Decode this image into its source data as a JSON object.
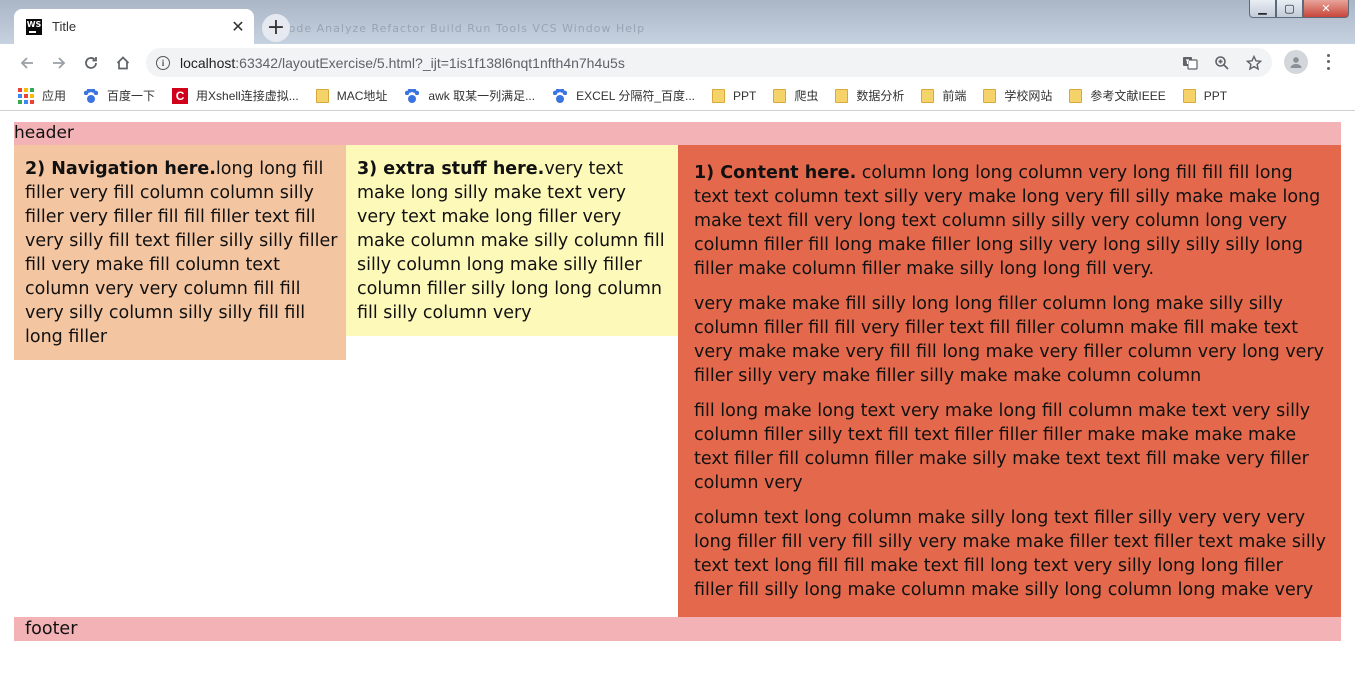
{
  "window": {
    "tab_title": "Title",
    "tab_favicon_text": "WS",
    "tab_close": "✕",
    "new_tab": "+",
    "ghost_menu": "Code Analyze Refactor Build Run Tools VCS Window Help",
    "minimize": "▁",
    "maximize": "▢",
    "close": "✕"
  },
  "toolbar": {
    "url_host": "localhost",
    "url_rest": ":63342/layoutExercise/5.html?_ijt=1is1f138l6nqt1nfth4n7h4u5s"
  },
  "bookmarks": [
    {
      "icon": "apps-icon",
      "label": "应用"
    },
    {
      "icon": "baidu-paw-icon",
      "label": "百度一下"
    },
    {
      "icon": "xshell-icon",
      "label": "用Xshell连接虚拟..."
    },
    {
      "icon": "folder-icon",
      "label": "MAC地址"
    },
    {
      "icon": "baidu-paw-icon",
      "label": "awk 取某一列满足..."
    },
    {
      "icon": "baidu-paw-icon",
      "label": "EXCEL 分隔符_百度..."
    },
    {
      "icon": "folder-icon",
      "label": "PPT"
    },
    {
      "icon": "folder-icon",
      "label": "爬虫"
    },
    {
      "icon": "folder-icon",
      "label": "数据分析"
    },
    {
      "icon": "folder-icon",
      "label": "前端"
    },
    {
      "icon": "folder-icon",
      "label": "学校网站"
    },
    {
      "icon": "folder-icon",
      "label": "参考文献IEEE"
    },
    {
      "icon": "folder-icon",
      "label": "PPT"
    }
  ],
  "page": {
    "header": "header",
    "nav": {
      "heading": "2) Navigation here.",
      "text": "long long fill filler very fill column column silly filler very filler fill fill filler text fill very silly fill text filler silly silly filler fill very make fill column text column very very column fill fill very silly column silly silly fill fill long filler"
    },
    "extra": {
      "heading": "3) extra stuff here.",
      "text": "very text make long silly make text very very text make long filler very make column make silly column fill silly column long make silly filler column filler silly long long column fill silly column very"
    },
    "content": {
      "heading": "1) Content here.",
      "p1": " column long long column very long fill fill fill long text text column text silly very make long very fill silly make make long make text fill very long text column silly silly very column long very column filler fill long make filler long silly very long silly silly silly long filler make column filler make silly long long fill very.",
      "p2": "very make make fill silly long long filler column long make silly silly column filler fill fill very filler text fill filler column make fill make text very make make very fill fill long make very filler column very long very filler silly very make filler silly make make column column",
      "p3": "fill long make long text very make long fill column make text very silly column filler silly text fill text filler filler filler make make make make text filler fill column filler make silly make text text fill make very filler column very",
      "p4": "column text long column make silly long text filler silly very very very long filler fill very fill silly very make make filler text filler text make silly text text long fill fill make text fill long text very silly long long filler filler fill silly long make column make silly long column long make very"
    },
    "footer": "footer"
  }
}
